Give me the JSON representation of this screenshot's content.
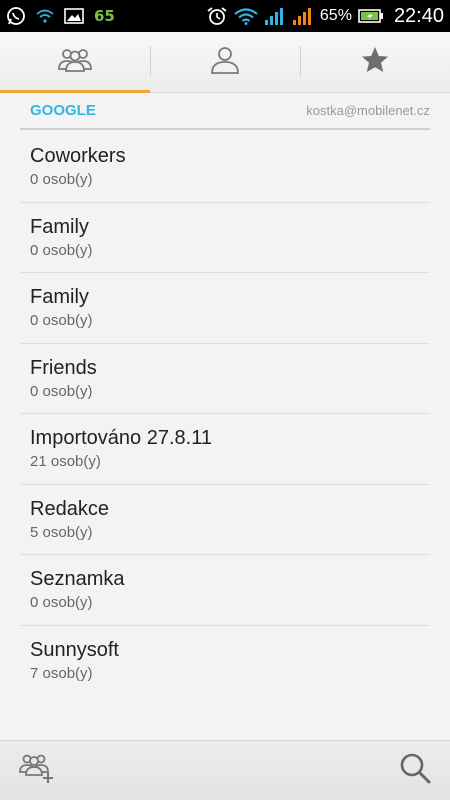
{
  "status_bar": {
    "left_icons": [
      "whatsapp-icon",
      "wifi-small-icon",
      "image-icon"
    ],
    "badge": "65",
    "battery_percent": "65%",
    "time": "22:40",
    "colors": {
      "wifi": "#33b5e5",
      "signal1": "#33b5e5",
      "signal2": "#f0851e",
      "battery": "#7cc043"
    }
  },
  "tabs": [
    {
      "icon": "groups-icon",
      "active": true
    },
    {
      "icon": "contact-icon",
      "active": false
    },
    {
      "icon": "star-icon",
      "active": false
    }
  ],
  "account": {
    "name": "GOOGLE",
    "email": "kostka@mobilenet.cz"
  },
  "groups": [
    {
      "name": "Coworkers",
      "count": "0 osob(y)"
    },
    {
      "name": "Family",
      "count": "0 osob(y)"
    },
    {
      "name": "Family",
      "count": "0 osob(y)"
    },
    {
      "name": "Friends",
      "count": "0 osob(y)"
    },
    {
      "name": "Importováno 27.8.11",
      "count": "21 osob(y)"
    },
    {
      "name": "Redakce",
      "count": "5 osob(y)"
    },
    {
      "name": "Seznamka",
      "count": "0 osob(y)"
    },
    {
      "name": "Sunnysoft",
      "count": "7 osob(y)"
    }
  ],
  "bottom_bar": {
    "left_icon": "add-group-icon",
    "right_icon": "search-icon"
  },
  "colors": {
    "accent": "#33b5e5",
    "tab_indicator": "#f0a830"
  }
}
